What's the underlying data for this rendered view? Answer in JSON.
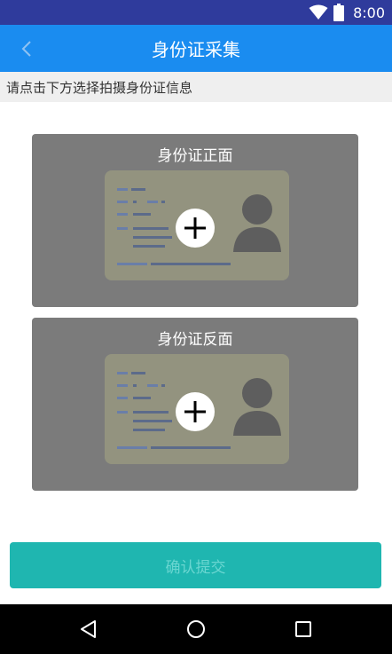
{
  "status_bar": {
    "time": "8:00"
  },
  "header": {
    "title": "身份证采集"
  },
  "hint": "请点击下方选择拍摄身份证信息",
  "cards": {
    "front": {
      "title": "身份证正面"
    },
    "back": {
      "title": "身份证反面"
    }
  },
  "submit": {
    "label": "确认提交"
  },
  "colors": {
    "status_bar": "#2f3b9c",
    "app_bar": "#1a8cf0",
    "card_overlay": "#7b7b7b",
    "submit_bg": "#1fb6b0",
    "submit_text": "#6ad6d1"
  },
  "icons": [
    "wifi-icon",
    "battery-icon",
    "back-arrow-icon",
    "add-icon",
    "nav-back-icon",
    "nav-home-icon",
    "nav-recents-icon"
  ]
}
